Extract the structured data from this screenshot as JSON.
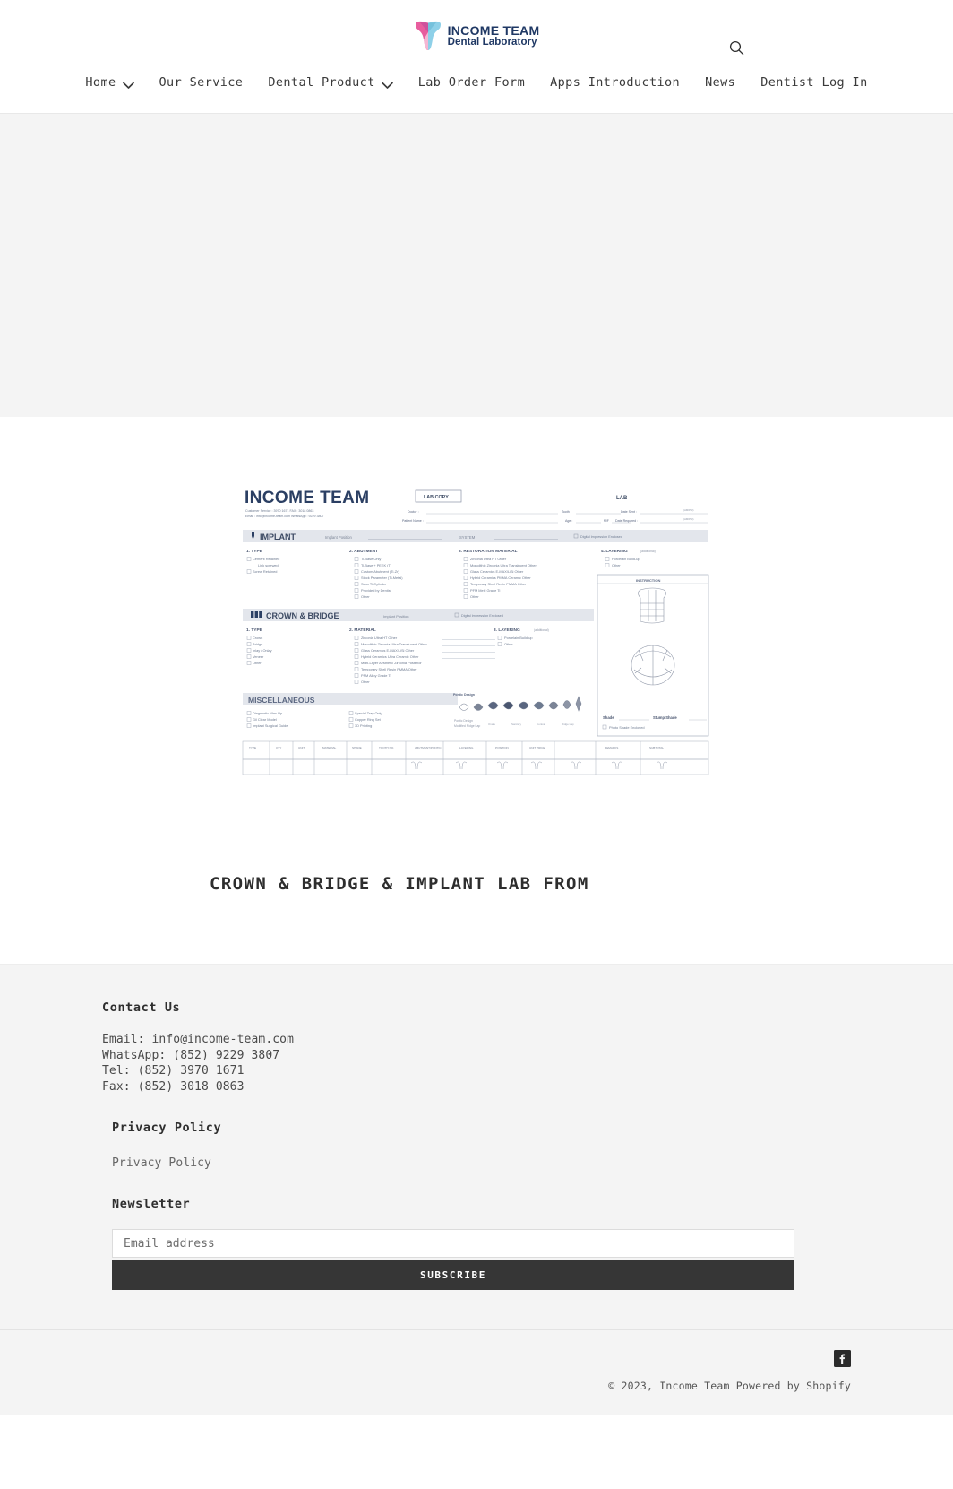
{
  "header": {
    "logo": {
      "line1": "INCOME TEAM",
      "line2": "Dental Laboratory",
      "icon": "tooth-logo-icon",
      "color_pink": "#e85d9e",
      "color_blue": "#7ec8e3",
      "color_text": "#1f3864"
    },
    "search_icon": "search-icon",
    "nav": [
      {
        "label": "Home",
        "has_dropdown": true
      },
      {
        "label": "Our Service",
        "has_dropdown": false
      },
      {
        "label": "Dental Product",
        "has_dropdown": true
      },
      {
        "label": "Lab Order Form",
        "has_dropdown": false
      },
      {
        "label": "Apps Introduction",
        "has_dropdown": false
      },
      {
        "label": "News",
        "has_dropdown": false
      },
      {
        "label": "Dentist Log In",
        "has_dropdown": false
      }
    ]
  },
  "article": {
    "title": "CROWN & BRIDGE & IMPLANT LAB FROM",
    "form_image": {
      "alt": "Income Team lab order form preview",
      "brand": "INCOME TEAM",
      "copy_tag": "LAB COPY",
      "lab_tag": "LAB",
      "contact_line1": "Customer Service : 3970 1671        FAX : 3018 0863",
      "contact_line2": "Email : info@income-team.com        WhatsApp : 9229 3807",
      "field_doctor": "Doctor :",
      "field_patient": "Patient Name :",
      "field_tooth": "Tooth :",
      "field_shade": "Shade :",
      "field_date_sent": "Date Sent :",
      "field_date_required": "Date Required :",
      "sections": [
        {
          "name": "IMPLANT",
          "note": "Implant Position",
          "system": "SYSTEM",
          "digital": "Digital Impression Enclosed",
          "columns": [
            {
              "heading": "1. TYPE",
              "items": [
                "Screw Retained",
                "Cement Retained",
                "Crown Retained"
              ]
            },
            {
              "heading": "2. ABUTMENT",
              "items": [
                "Ti-Base Only",
                "Ti-Base + PEEK Tii",
                "Custom Abutment Ti-Zr",
                "Stock Titanium Ti-Metal",
                "Scan Ti-Cylinder",
                "Provided by Dentist",
                "Other"
              ]
            },
            {
              "heading": "3. RESTORATION MATERIAL",
              "items": [
                "Zirconia Ultra HT Other",
                "Monolithic Zirconia Ultra Translucent Other",
                "Glass Ceramics E-MAX/LiSi Other",
                "Hybrid Ceramics PMMA Other",
                "Temporary Shell Resin PMMA Other",
                "PFM Metal Grade Ti",
                "Other"
              ]
            },
            {
              "heading": "4. LAYERING",
              "note": "additional",
              "items": [
                "Porcelain Build-up",
                "Other"
              ]
            }
          ]
        },
        {
          "name": "CROWN & BRIDGE",
          "note": "Digital Impression Enclosed",
          "columns": [
            {
              "heading": "1. TYPE",
              "items": [
                "Crown",
                "Bridge",
                "Inlay / Onlay",
                "Veneer",
                "Other"
              ]
            },
            {
              "heading": "2. MATERIAL",
              "items": [
                "Zirconia Ultra HT Other",
                "Monolithic Zirconia Ultra Translucent Other",
                "Glass Ceramics E-MAX/LiSi Other",
                "Hybrid Ceramics Ultra Ceramic Other",
                "Multi-Layer Aesthetic Zirconia Posterior",
                "Temporary Shell Resin PMMA Other",
                "PFM Alloy Grade Ti",
                "Other"
              ]
            },
            {
              "heading": "3. LAYERING",
              "note": "additional",
              "items": [
                "Porcelain Build-up",
                "Other"
              ]
            }
          ]
        },
        {
          "name": "MISCELLANEOUS",
          "columns": [
            {
              "heading": "",
              "items": [
                "Diagnostic Wax-Up",
                "Gil Clear Model",
                "Implant Surgical Guide"
              ]
            },
            {
              "heading": "",
              "items": [
                "Special Tray Only",
                "Copper Ring Set",
                "3D Printing"
              ]
            }
          ]
        }
      ],
      "instruction_label": "INSTRUCTION",
      "pontic_label": "Pontic Design",
      "shade_label": "Shade",
      "stump_label": "Stump Shade",
      "photo_label": "Photo Shade Enclosed"
    }
  },
  "footer": {
    "contact": {
      "heading": "Contact Us",
      "lines": [
        "Email: info@income-team.com",
        "WhatsApp: (852) 9229 3807",
        "Tel: (852) 3970 1671",
        "Fax: (852) 3018 0863"
      ]
    },
    "privacy": {
      "heading": "Privacy Policy",
      "link_label": "Privacy Policy"
    },
    "newsletter": {
      "heading": "Newsletter",
      "placeholder": "Email address",
      "value": "",
      "subscribe_label": "SUBSCRIBE",
      "button_color": "#363636"
    },
    "social": [
      {
        "name": "facebook-icon",
        "label": "Facebook"
      }
    ],
    "copyright": {
      "text": "© 2023, ",
      "store": "Income Team",
      "separator": " ",
      "powered_by": "Powered by Shopify"
    }
  }
}
